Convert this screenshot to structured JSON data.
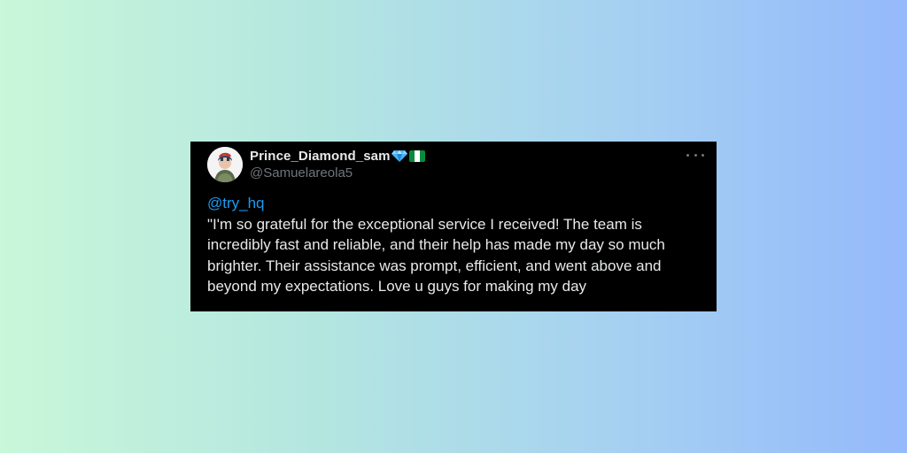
{
  "tweet": {
    "display_name": "Prince_Diamond_sam",
    "handle": "@Samuelareola5",
    "badges": [
      "gem-icon",
      "nigeria-flag-icon"
    ],
    "more_icon": "more-horizontal-icon",
    "mention": "@try_hq",
    "text": "\"I'm so grateful for the exceptional service I received! The team is incredibly fast and reliable, and their help has made my day so much brighter. Their assistance was prompt, efficient, and went above and beyond my expectations. Love u guys for making my day"
  },
  "colors": {
    "card_background": "#000000",
    "text_primary": "#e7e9ea",
    "text_secondary": "#71767b",
    "mention_blue": "#1d9bf0",
    "gradient_left": "#c9f7d9",
    "gradient_right": "#95b9fb"
  }
}
